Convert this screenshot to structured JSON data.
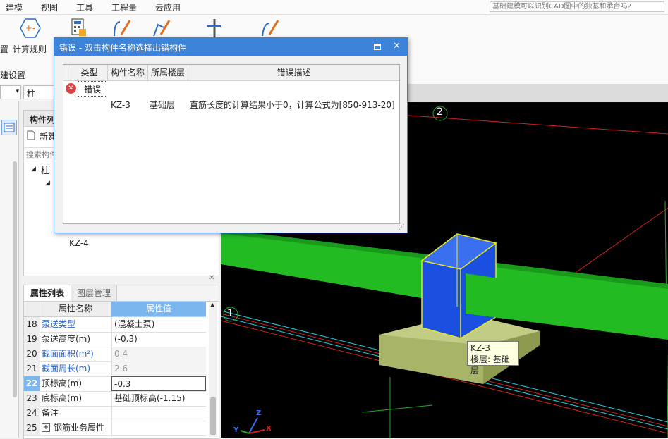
{
  "menu": {
    "items": [
      "建模",
      "视图",
      "工具",
      "工程量",
      "云应用"
    ],
    "search_placeholder": "基础建模可以识别CAD图中的独基和承台吗?"
  },
  "ribbon": {
    "partial_label_left": "置",
    "calc_rules_label": "计算规则",
    "group_label": "建设置"
  },
  "left": {
    "combo_left_value": "",
    "combo_type_value": "柱",
    "component_list_title": "构件列",
    "new_button_label": "新建",
    "search_placeholder": "搜索构件",
    "tree": {
      "root": "柱",
      "leaf": "KZ-4"
    }
  },
  "properties": {
    "tabs": [
      "属性列表",
      "图层管理"
    ],
    "header_name": "属性名称",
    "header_value": "属性值",
    "rows": [
      {
        "num": "18",
        "name": "泵送类型",
        "value": "(混凝土泵)"
      },
      {
        "num": "19",
        "name": "泵送高度(m)",
        "value": "(-0.3)"
      },
      {
        "num": "20",
        "name": "截面面积(m²)",
        "value": "0.4"
      },
      {
        "num": "21",
        "name": "截面周长(m)",
        "value": "2.6"
      },
      {
        "num": "22",
        "name": "顶标高(m)",
        "value": "-0.3"
      },
      {
        "num": "23",
        "name": "底标高(m)",
        "value": "基础顶标高(-1.15)"
      },
      {
        "num": "24",
        "name": "备注",
        "value": ""
      },
      {
        "num": "25",
        "name": "钢筋业务属性",
        "value": ""
      }
    ]
  },
  "viewport": {
    "axis_2": "2",
    "axis_1": "1",
    "tooltip": {
      "line1": "KZ-3",
      "line2": "楼层: 基础层"
    }
  },
  "dialog": {
    "title": "错误 - 双击构件名称选择出错构件",
    "columns": [
      "类型",
      "构件名称",
      "所属楼层",
      "错误描述"
    ],
    "rows": [
      {
        "type": "错误",
        "name": "KZ-3",
        "floor": "基础层",
        "desc": "直筋长度的计算结果小于0，计算公式为[850-913-20]"
      }
    ]
  },
  "colors": {
    "dialog_title": "#3c84d9",
    "beam_green": "#22bb22",
    "column_blue": "#1a4fe0",
    "footing": "#a8b468",
    "error_red": "#e04040"
  }
}
